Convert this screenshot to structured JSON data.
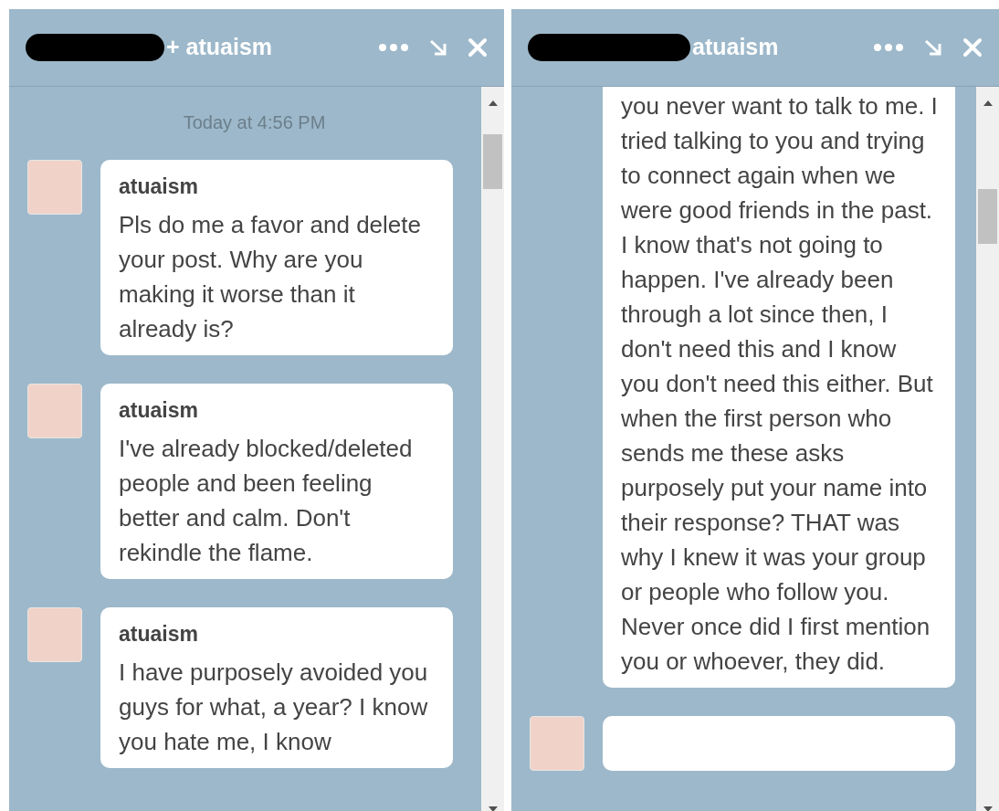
{
  "windows": [
    {
      "title": "+ atuaism",
      "redacted": true,
      "timestamp": "Today at 4:56 PM",
      "messages": [
        {
          "sender": "atuaism",
          "text": "Pls do me a favor and delete your post. Why are you making it worse than it already is?",
          "cut_top": false
        },
        {
          "sender": "atuaism",
          "text": "I've already blocked/deleted people and been feeling better and calm. Don't rekindle the flame.",
          "cut_top": false
        },
        {
          "sender": "atuaism",
          "text": "I have purposely avoided you guys for what, a year? I know you hate me, I know",
          "cut_top": false
        }
      ]
    },
    {
      "title": "atuaism",
      "redacted": true,
      "messages": [
        {
          "text": "you never want to talk to me. I tried talking to you and trying to connect again when we were good friends in the past. I know that's not going to happen. I've already been through a lot since then, I don't need this and I know you don't need this either. But when the first person who sends me these asks purposely put your name into their response? THAT was why I knew it was your group or people who follow you. Never once did I first mention you or whoever, they did.",
          "cut_top": true
        },
        {
          "cut_top": false
        }
      ]
    }
  ]
}
